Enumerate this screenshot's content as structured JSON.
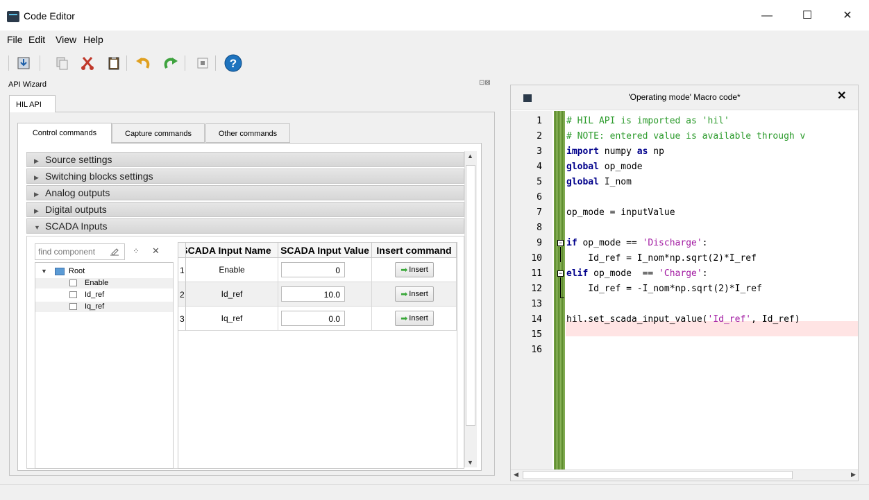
{
  "window": {
    "title": "Code Editor",
    "minimize": "—",
    "maximize": "☐",
    "close": "✕"
  },
  "menu": [
    "File",
    "Edit",
    "View",
    "Help"
  ],
  "wizard": {
    "title": "API Wizard",
    "dock_buttons": "⊡⊠",
    "main_tab": "HIL API",
    "tabs": [
      "Control commands",
      "Capture commands",
      "Other commands"
    ],
    "sections": [
      {
        "label": "Source settings",
        "expanded": false
      },
      {
        "label": "Switching blocks settings",
        "expanded": false
      },
      {
        "label": "Analog outputs",
        "expanded": false
      },
      {
        "label": "Digital outputs",
        "expanded": false
      },
      {
        "label": "SCADA Inputs",
        "expanded": true
      }
    ],
    "search_placeholder": "find component",
    "tree": {
      "root": "Root",
      "children": [
        "Enable",
        "Id_ref",
        "Iq_ref"
      ]
    },
    "table": {
      "headers": [
        "SCADA Input Name",
        "SCADA Input Value",
        "Insert command"
      ],
      "rows": [
        {
          "num": "1",
          "name": "Enable",
          "value": "0",
          "button": "Insert"
        },
        {
          "num": "2",
          "name": "Id_ref",
          "value": "10.0",
          "button": "Insert"
        },
        {
          "num": "3",
          "name": "Iq_ref",
          "value": "0.0",
          "button": "Insert"
        }
      ]
    }
  },
  "macro": {
    "title": "'Operating mode' Macro code*",
    "close": "✕",
    "line_numbers": [
      "1",
      "2",
      "3",
      "4",
      "5",
      "6",
      "7",
      "8",
      "9",
      "10",
      "11",
      "12",
      "13",
      "14",
      "15",
      "16"
    ],
    "code": {
      "l1": "# HIL API is imported as 'hil'",
      "l2": "# NOTE: entered value is available through v",
      "l3a": "import",
      "l3b": " numpy ",
      "l3c": "as",
      "l3d": " np",
      "l4a": "global",
      "l4b": " op_mode",
      "l5a": "global",
      "l5b": " I_nom",
      "l7": "op_mode = inputValue",
      "l9a": "if",
      "l9b": " op_mode == ",
      "l9c": "'Discharge'",
      "l9d": ":",
      "l10a": "    Id_ref = I_nom*np.sqrt(",
      "l10b": "2",
      "l10c": ")*I_ref",
      "l11a": "elif",
      "l11b": " op_mode  == ",
      "l11c": "'Charge'",
      "l11d": ":",
      "l12a": "    Id_ref = -I_nom*np.sqrt(",
      "l12b": "2",
      "l12c": ")*I_ref",
      "l14a": "hil.set_scada_input_value(",
      "l14b": "'Id_ref'",
      "l14c": ", Id_ref)"
    }
  }
}
